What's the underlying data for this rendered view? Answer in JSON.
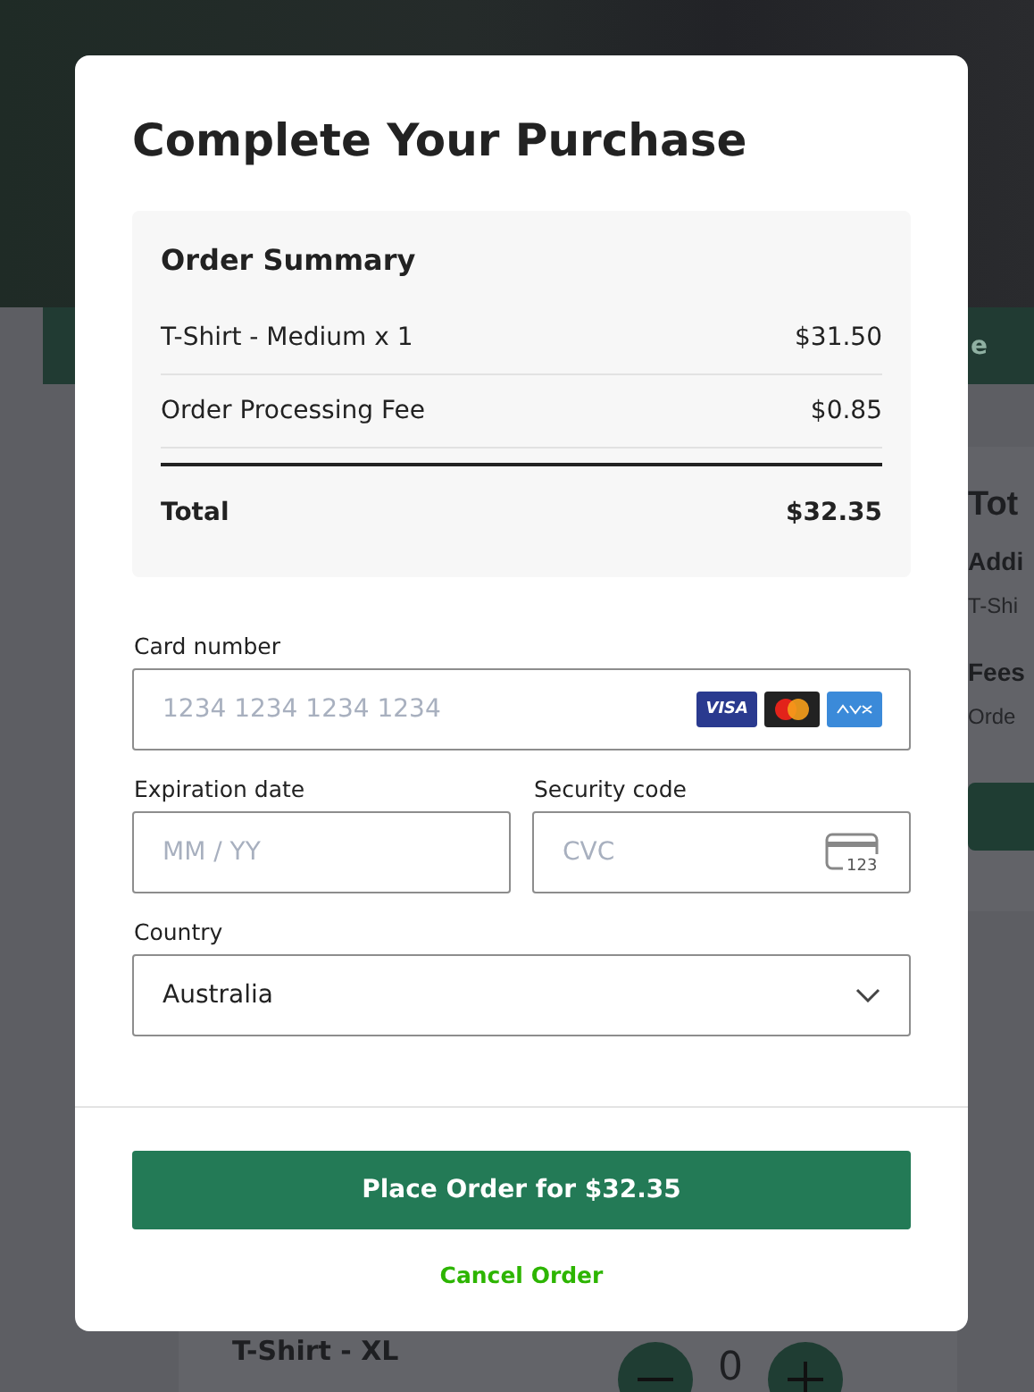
{
  "background": {
    "nav_text": "e",
    "side_card": {
      "title": "Tot",
      "sections": [
        {
          "heading": "Addi",
          "text": "T-Shi"
        },
        {
          "heading": "Fees",
          "text": "Orde"
        }
      ]
    },
    "product": {
      "name": "T-Shirt - XL",
      "quantity": "0"
    }
  },
  "modal": {
    "title": "Complete Your Purchase",
    "summary": {
      "heading": "Order Summary",
      "items": [
        {
          "label": "T-Shirt - Medium x 1",
          "amount": "$31.50"
        },
        {
          "label": "Order Processing Fee",
          "amount": "$0.85"
        }
      ],
      "total": {
        "label": "Total",
        "amount": "$32.35"
      }
    },
    "card_number": {
      "label": "Card number",
      "placeholder": "1234 1234 1234 1234",
      "brand": "VISA"
    },
    "expiration": {
      "label": "Expiration date",
      "placeholder": "MM / YY"
    },
    "security_code": {
      "label": "Security code",
      "placeholder": "CVC",
      "icon_text": "123"
    },
    "country": {
      "label": "Country",
      "value": "Australia"
    },
    "place_order": "Place Order for $32.35",
    "cancel": "Cancel Order"
  }
}
